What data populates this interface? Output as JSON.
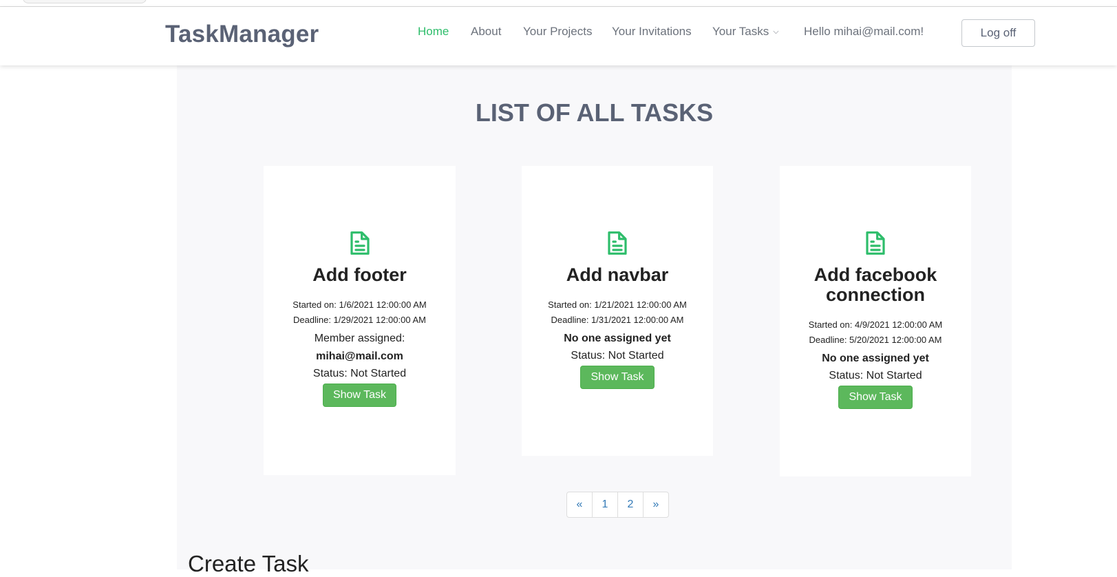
{
  "brand": "TaskManager",
  "nav": {
    "home": "Home",
    "about": "About",
    "projects": "Your Projects",
    "invitations": "Your Invitations",
    "tasks": "Your Tasks",
    "greeting": "Hello mihai@mail.com!",
    "logoff": "Log off"
  },
  "colors": {
    "accent_green": "#2ebd6b",
    "button_green": "#5cb85c",
    "heading": "#5a6275",
    "link_blue": "#337ab7"
  },
  "page_title": "LIST OF ALL TASKS",
  "tasks": [
    {
      "icon": "file-text-icon",
      "title": "Add footer",
      "started": "Started on: 1/6/2021 12:00:00 AM",
      "deadline": "Deadline: 1/29/2021 12:00:00 AM",
      "assigned_label": "Member assigned:",
      "assigned_value": "mihai@mail.com",
      "status": "Status: Not Started",
      "button": "Show Task"
    },
    {
      "icon": "file-text-icon",
      "title": "Add navbar",
      "started": "Started on: 1/21/2021 12:00:00 AM",
      "deadline": "Deadline: 1/31/2021 12:00:00 AM",
      "assigned_value": "No one assigned yet",
      "status": "Status: Not Started",
      "button": "Show Task"
    },
    {
      "icon": "file-text-icon",
      "title": "Add facebook connection",
      "started": "Started on: 4/9/2021 12:00:00 AM",
      "deadline": "Deadline: 5/20/2021 12:00:00 AM",
      "assigned_value": "No one assigned yet",
      "status": "Status: Not Started",
      "button": "Show Task"
    }
  ],
  "pagination": {
    "prev": "«",
    "pages": [
      "1",
      "2"
    ],
    "next": "»"
  },
  "create_heading": "Create Task"
}
